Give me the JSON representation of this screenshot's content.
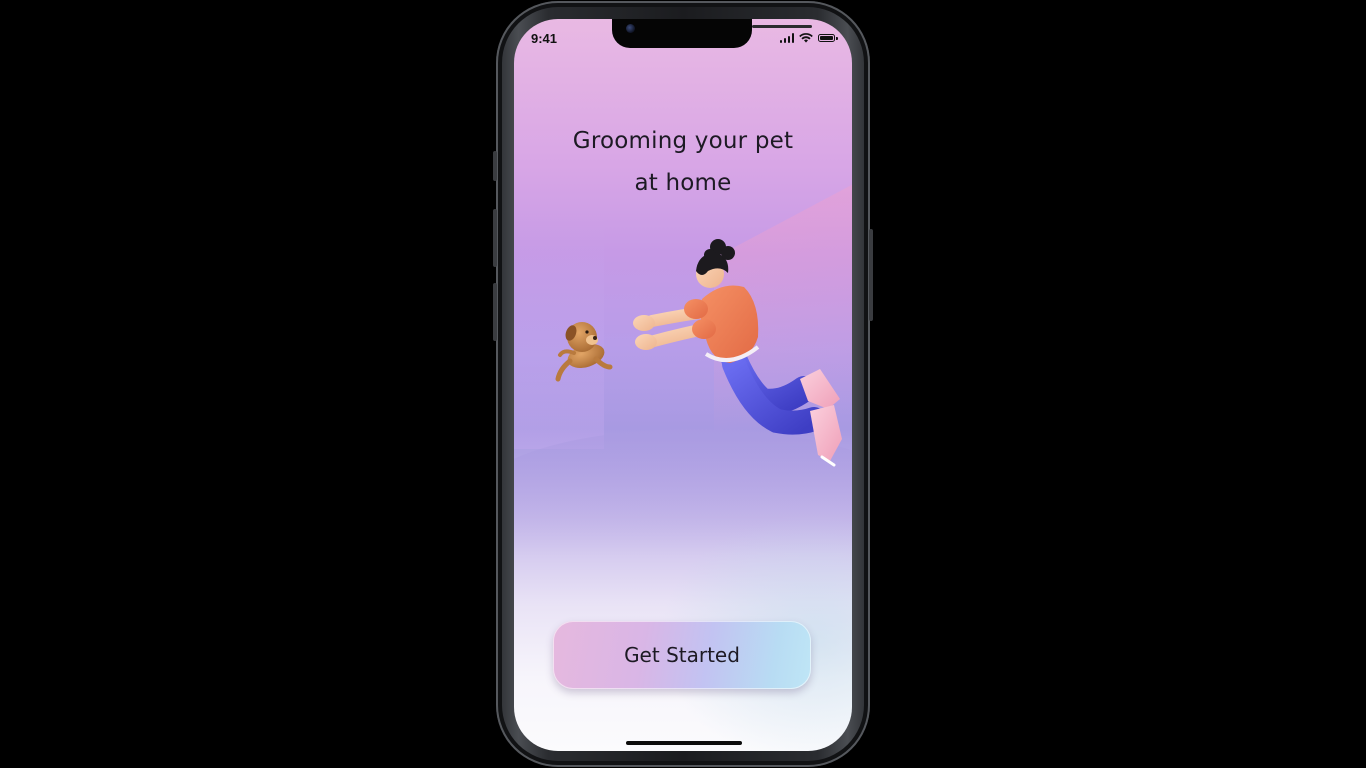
{
  "status_bar": {
    "time": "9:41"
  },
  "onboarding": {
    "title_line_1": "Grooming your pet",
    "title_line_2": "at home",
    "cta_label": "Get Started"
  },
  "colors": {
    "page_background": "#000000",
    "screen_top": "#e9b9e3",
    "screen_mid": "#b79de9",
    "screen_bottom": "#fbfbfd",
    "text": "#1d1a24",
    "shirt": "#ee7a52",
    "pants": "#4d4fd8",
    "shoes": "#f3b7cc",
    "dog": "#c98a4a"
  },
  "icons": {
    "signal": "cellular-signal-icon",
    "wifi": "wifi-icon",
    "battery": "battery-icon"
  }
}
